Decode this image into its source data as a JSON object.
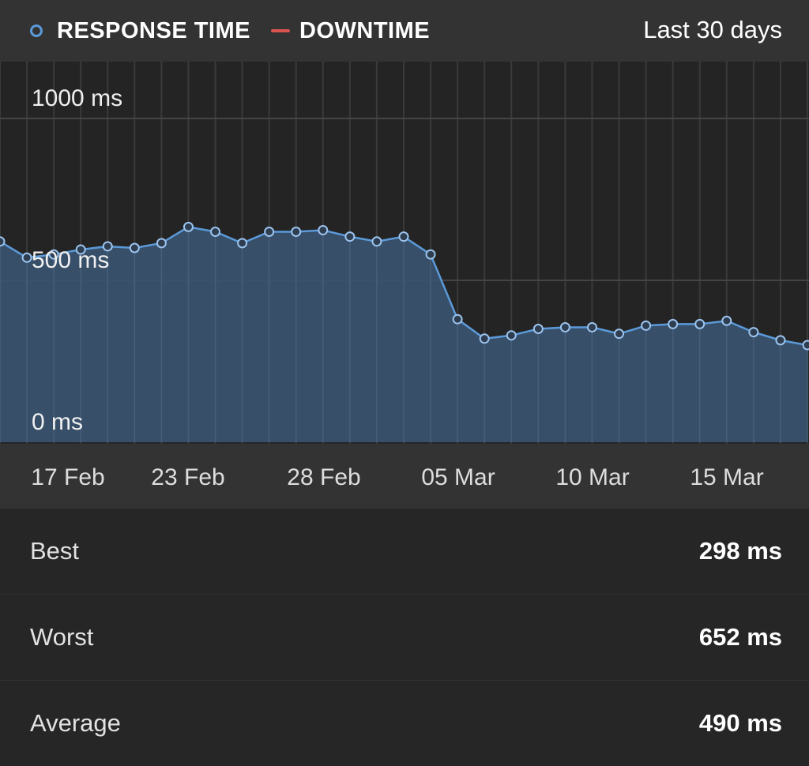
{
  "legend": {
    "response_time_label": "RESPONSE TIME",
    "downtime_label": "DOWNTIME",
    "response_time_color": "#5b9ad9",
    "downtime_color": "#d9534f"
  },
  "period_label": "Last 30 days",
  "chart_data": {
    "type": "area",
    "series": [
      {
        "values": [
          620,
          570,
          580,
          595,
          605,
          600,
          615,
          665,
          650,
          615,
          650,
          650,
          655,
          635,
          620,
          635,
          580,
          380,
          320,
          330,
          350,
          355,
          355,
          335,
          360,
          365,
          365,
          375,
          340,
          315,
          300
        ]
      }
    ],
    "x_tick_labels": [
      "17 Feb",
      "23 Feb",
      "28 Feb",
      "05 Mar",
      "10 Mar",
      "15 Mar"
    ],
    "y_tick_labels": [
      "1000 ms",
      "500 ms",
      "0 ms"
    ],
    "y_ticks": [
      1000,
      500,
      0
    ],
    "ylim": [
      0,
      1000
    ],
    "grid": true,
    "color": "#5b9ad9",
    "fill_color": "#3b5470"
  },
  "stats": [
    {
      "label": "Best",
      "value": "298 ms"
    },
    {
      "label": "Worst",
      "value": "652 ms"
    },
    {
      "label": "Average",
      "value": "490 ms"
    }
  ]
}
